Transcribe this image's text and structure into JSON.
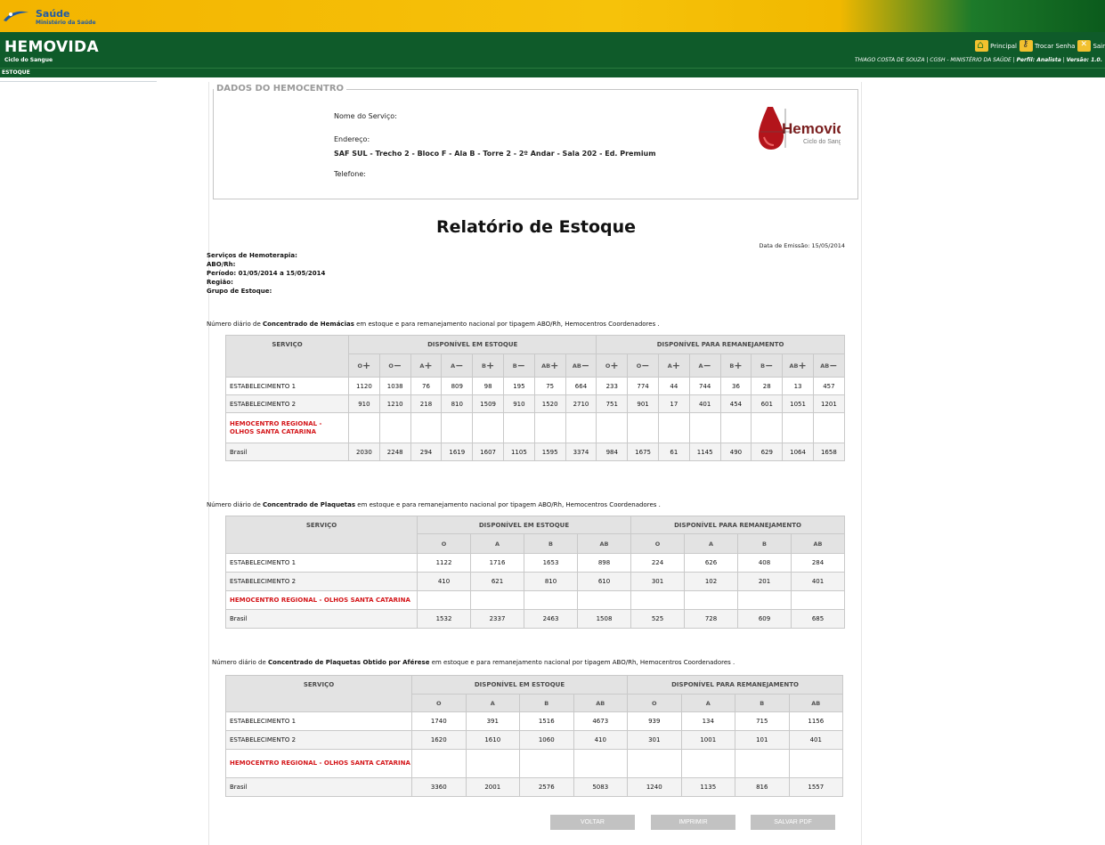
{
  "gov": {
    "brand": "Saúde",
    "ministry": "Ministério da Saúde"
  },
  "header": {
    "title": "HEMOVIDA",
    "subtitle": "Ciclo do Sangue",
    "actions": [
      {
        "label": "Principal"
      },
      {
        "label": "Trocar Senha"
      },
      {
        "label": "Sair"
      }
    ],
    "user": "THIAGO COSTA DE SOUZA | CGSH - MINISTÉRIO DA SAÚDE",
    "profile": "Perfil: Analista",
    "version": "Versão: 1.0."
  },
  "nav": {
    "crumb": "ESTOQUE"
  },
  "hemocentro": {
    "legend": "DADOS DO HEMOCENTRO",
    "service_label": "Nome do Serviço:",
    "address_label": "Endereço:",
    "address_value": "SAF SUL - Trecho 2 - Bloco F - Ala B - Torre 2 - 2º Andar - Sala 202 - Ed. Premium",
    "phone_label": "Telefone:",
    "logo_text": "Hemovida",
    "logo_sub": "Ciclo do Sangue"
  },
  "report": {
    "title": "Relatório de Estoque",
    "emissao": "Data de Emissão: 15/05/2014",
    "filters": [
      "Serviços de Hemoterapia:",
      "ABO/Rh:",
      "Período: 01/05/2014 a 15/05/2014",
      "Região:",
      "Grupo de Estoque:"
    ]
  },
  "table1": {
    "caption_pre": "Número diário de ",
    "caption_bold": "Concentrado de Hemácias",
    "caption_post": " em estoque e para remanejamento nacional por tipagem ABO/Rh, Hemocentros Coordenadores .",
    "col_service": "SERVIÇO",
    "col_stock": "DISPONÍVEL EM ESTOQUE",
    "col_realloc": "DISPONÍVEL PARA REMANEJAMENTO",
    "types": [
      {
        "g": "O",
        "s": "+"
      },
      {
        "g": "O",
        "s": "−"
      },
      {
        "g": "A",
        "s": "+"
      },
      {
        "g": "A",
        "s": "−"
      },
      {
        "g": "B",
        "s": "+"
      },
      {
        "g": "B",
        "s": "−"
      },
      {
        "g": "AB",
        "s": "+"
      },
      {
        "g": "AB",
        "s": "−"
      },
      {
        "g": "O",
        "s": "+"
      },
      {
        "g": "O",
        "s": "−"
      },
      {
        "g": "A",
        "s": "+"
      },
      {
        "g": "A",
        "s": "−"
      },
      {
        "g": "B",
        "s": "+"
      },
      {
        "g": "B",
        "s": "−"
      },
      {
        "g": "AB",
        "s": "+"
      },
      {
        "g": "AB",
        "s": "−"
      }
    ],
    "rows": [
      {
        "name": "ESTABELECIMENTO 1",
        "red": false,
        "vals": [
          "1120",
          "1038",
          "76",
          "809",
          "98",
          "195",
          "75",
          "664",
          "233",
          "774",
          "44",
          "744",
          "36",
          "28",
          "13",
          "457"
        ]
      },
      {
        "name": "ESTABELECIMENTO 2",
        "red": false,
        "vals": [
          "910",
          "1210",
          "218",
          "810",
          "1509",
          "910",
          "1520",
          "2710",
          "751",
          "901",
          "17",
          "401",
          "454",
          "601",
          "1051",
          "1201"
        ]
      },
      {
        "name": "HEMOCENTRO REGIONAL - OLHOS SANTA CATARINA",
        "red": true,
        "vals": [
          "",
          "",
          "",
          "",
          "",
          "",
          "",
          "",
          "",
          "",
          "",
          "",
          "",
          "",
          "",
          ""
        ]
      },
      {
        "name": "Brasil",
        "red": false,
        "vals": [
          "2030",
          "2248",
          "294",
          "1619",
          "1607",
          "1105",
          "1595",
          "3374",
          "984",
          "1675",
          "61",
          "1145",
          "490",
          "629",
          "1064",
          "1658"
        ]
      }
    ]
  },
  "table2": {
    "caption_pre": "Número diário de ",
    "caption_bold": "Concentrado de Plaquetas",
    "caption_post": " em estoque e para remanejamento nacional por tipagem ABO/Rh, Hemocentros Coordenadores .",
    "col_service": "SERVIÇO",
    "col_stock": "DISPONÍVEL EM ESTOQUE",
    "col_realloc": "DISPONÍVEL PARA REMANEJAMENTO",
    "types": [
      "O",
      "A",
      "B",
      "AB",
      "O",
      "A",
      "B",
      "AB"
    ],
    "rows": [
      {
        "name": "ESTABELECIMENTO 1",
        "red": false,
        "vals": [
          "1122",
          "1716",
          "1653",
          "898",
          "224",
          "626",
          "408",
          "284"
        ]
      },
      {
        "name": "ESTABELECIMENTO 2",
        "red": false,
        "vals": [
          "410",
          "621",
          "810",
          "610",
          "301",
          "102",
          "201",
          "401"
        ]
      },
      {
        "name": "HEMOCENTRO REGIONAL - OLHOS SANTA CATARINA",
        "red": true,
        "vals": [
          "",
          "",
          "",
          "",
          "",
          "",
          "",
          ""
        ]
      },
      {
        "name": "Brasil",
        "red": false,
        "vals": [
          "1532",
          "2337",
          "2463",
          "1508",
          "525",
          "728",
          "609",
          "685"
        ]
      }
    ]
  },
  "table3": {
    "caption_pre": "Número diário de ",
    "caption_bold": "Concentrado de Plaquetas Obtido por Aférese",
    "caption_post": " em estoque e para remanejamento nacional por tipagem ABO/Rh, Hemocentros Coordenadores .",
    "col_service": "SERVIÇO",
    "col_stock": "DISPONÍVEL EM ESTOQUE",
    "col_realloc": "DISPONÍVEL PARA REMANEJAMENTO",
    "types": [
      "O",
      "A",
      "B",
      "AB",
      "O",
      "A",
      "B",
      "AB"
    ],
    "rows": [
      {
        "name": "ESTABELECIMENTO 1",
        "red": false,
        "vals": [
          "1740",
          "391",
          "1516",
          "4673",
          "939",
          "134",
          "715",
          "1156"
        ]
      },
      {
        "name": "ESTABELECIMENTO 2",
        "red": false,
        "vals": [
          "1620",
          "1610",
          "1060",
          "410",
          "301",
          "1001",
          "101",
          "401"
        ]
      },
      {
        "name": "HEMOCENTRO REGIONAL - OLHOS SANTA CATARINA",
        "red": true,
        "vals": [
          "",
          "",
          "",
          "",
          "",
          "",
          "",
          ""
        ]
      },
      {
        "name": "Brasil",
        "red": false,
        "vals": [
          "3360",
          "2001",
          "2576",
          "5083",
          "1240",
          "1135",
          "816",
          "1557"
        ]
      }
    ]
  },
  "buttons": {
    "back": "VOLTAR",
    "print": "IMPRIMIR",
    "pdf": "SALVAR PDF"
  }
}
